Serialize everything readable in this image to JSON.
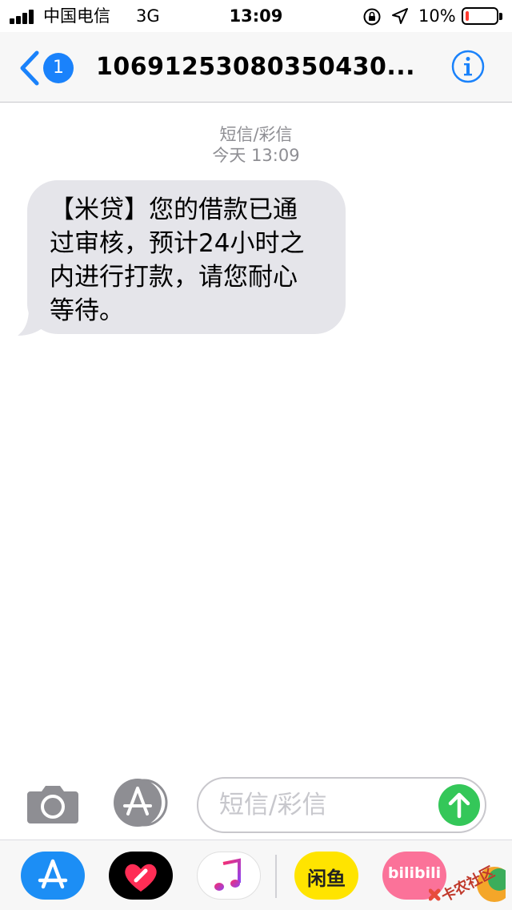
{
  "status_bar": {
    "carrier": "中国电信",
    "network": "3G",
    "time": "13:09",
    "battery_percent": "10%",
    "battery_level": 0.1
  },
  "nav": {
    "back_badge": "1",
    "title": "10691253080350430..."
  },
  "conversation": {
    "message_type": "短信/彩信",
    "timestamp": "今天 13:09",
    "messages": [
      {
        "lines": [
          "【米贷】您的借款已通",
          "过审核，预计24小时之",
          "内进行打款，请您耐心",
          "等待。"
        ]
      }
    ]
  },
  "input": {
    "placeholder": "短信/彩信"
  },
  "app_drawer": {
    "apps": [
      {
        "name": "app-store-icon",
        "color": "#1c8ef5"
      },
      {
        "name": "digital-touch-icon",
        "color": "#000000"
      },
      {
        "name": "music-icon",
        "color": "#ffffff"
      },
      {
        "name": "xianyu-icon",
        "label": "闲鱼",
        "color": "#ffe400"
      },
      {
        "name": "bilibili-icon",
        "label": "bilibili",
        "color": "#fb7299"
      }
    ]
  },
  "watermark": "卡农社区",
  "colors": {
    "accent": "#1a82fb",
    "bubble": "#e5e5ea",
    "send": "#34c759",
    "battery_low": "#ff3b30"
  }
}
